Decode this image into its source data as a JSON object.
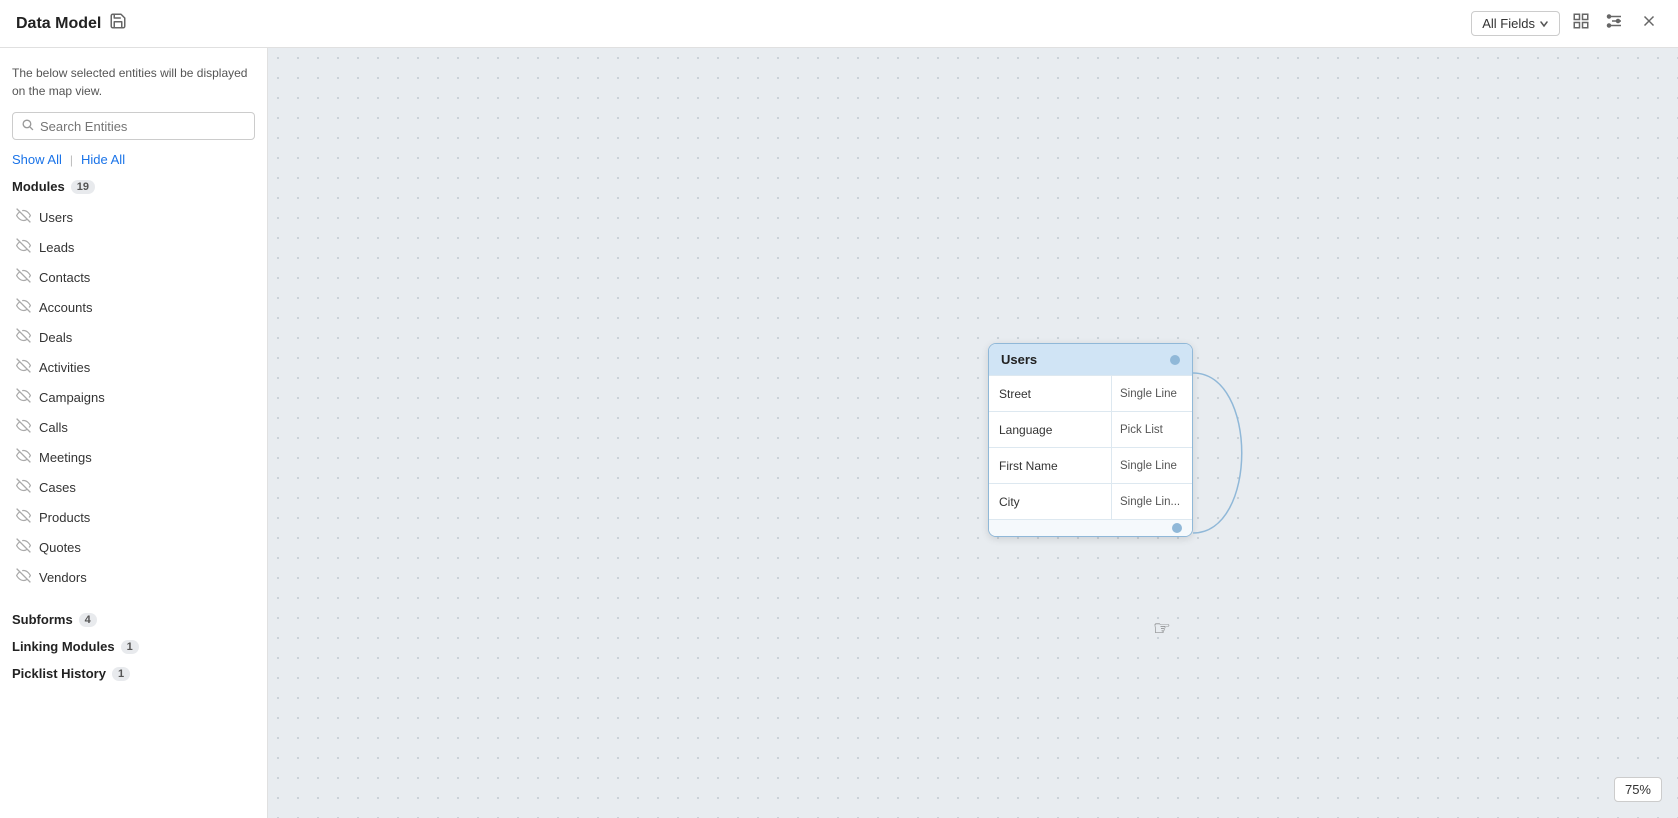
{
  "header": {
    "title": "Data Model",
    "save_icon": "💾",
    "all_fields_label": "All Fields",
    "icon_layout": "⊟",
    "icon_settings": "⊞",
    "icon_close": "✕"
  },
  "sidebar": {
    "description": "The below selected entities will be displayed on the map view.",
    "search_placeholder": "Search Entities",
    "show_all": "Show All",
    "hide_all": "Hide All",
    "modules_label": "Modules",
    "modules_count": "19",
    "modules": [
      "Users",
      "Leads",
      "Contacts",
      "Accounts",
      "Deals",
      "Activities",
      "Campaigns",
      "Calls",
      "Meetings",
      "Cases",
      "Products",
      "Quotes",
      "Vendors"
    ],
    "subforms_label": "Subforms",
    "subforms_count": "4",
    "linking_modules_label": "Linking Modules",
    "linking_modules_count": "1",
    "picklist_history_label": "Picklist History",
    "picklist_history_count": "1"
  },
  "canvas": {
    "users_card": {
      "title": "Users",
      "rows": [
        {
          "field": "Street",
          "type": "Single Line"
        },
        {
          "field": "Language",
          "type": "Pick List"
        },
        {
          "field": "First Name",
          "type": "Single Line"
        },
        {
          "field": "City",
          "type": "Single Lin..."
        }
      ]
    }
  },
  "zoom": {
    "level": "75%"
  }
}
